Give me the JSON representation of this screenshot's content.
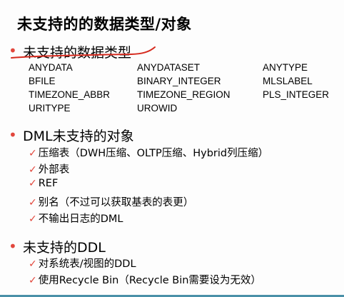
{
  "title": "未支持的的数据类型/对象",
  "bullet_symbol": "•",
  "check_symbol": "✓",
  "sections": [
    {
      "heading": "未支持的数据类型",
      "types": [
        [
          "ANYDATA",
          "ANYDATASET",
          "ANYTYPE"
        ],
        [
          "BFILE",
          "BINARY_INTEGER",
          "MLSLABEL"
        ],
        [
          "TIMEZONE_ABBR",
          "TIMEZONE_REGION",
          "PLS_INTEGER"
        ],
        [
          "URITYPE",
          "UROWID",
          ""
        ]
      ]
    },
    {
      "heading": "DML未支持的对象",
      "items": [
        "压缩表（DWH压缩、OLTP压缩、Hybrid列压缩）",
        "外部表",
        "REF",
        "别名（不过可以获取基表的表更）",
        "不输出日志的DML"
      ]
    },
    {
      "heading": "未支持的DDL",
      "items": [
        "对系统表/视图的DDL",
        "使用Recycle Bin（Recycle Bin需要设为无效）"
      ]
    }
  ],
  "colors": {
    "bullet": "#e2473c",
    "underline": "#d62a1e",
    "bottom_bar": "#4a90a8"
  }
}
